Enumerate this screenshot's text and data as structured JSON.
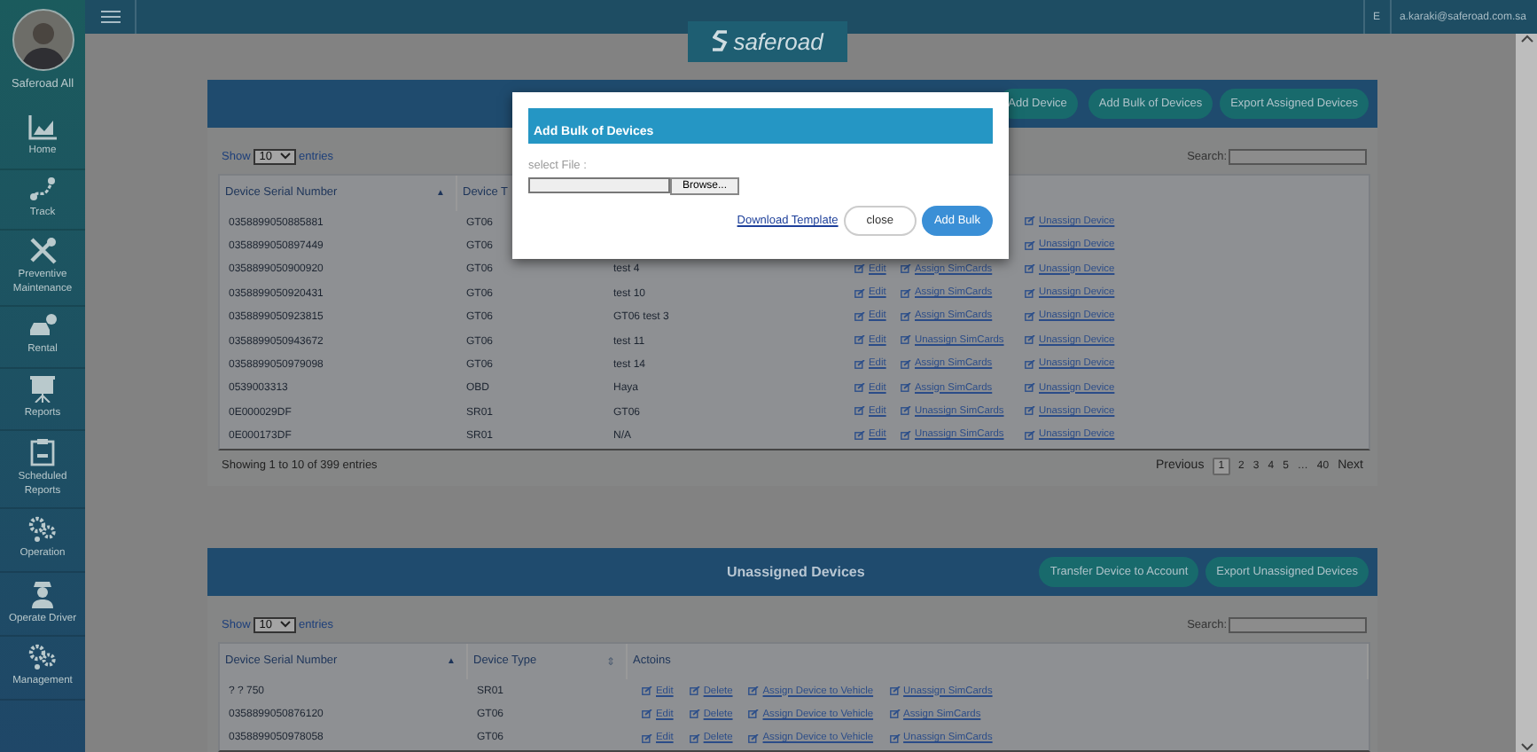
{
  "profile": {
    "name": "Saferoad All"
  },
  "sidebar": [
    {
      "label": "Home"
    },
    {
      "label": "Track"
    },
    {
      "label": "Preventive Maintenance"
    },
    {
      "label": "Rental"
    },
    {
      "label": "Reports"
    },
    {
      "label": "Scheduled Reports"
    },
    {
      "label": "Operation"
    },
    {
      "label": "Operate Driver"
    },
    {
      "label": "Management"
    }
  ],
  "topbar": {
    "language": "E",
    "user_email": "a.karaki@saferoad.com.sa"
  },
  "logo": "saferoad",
  "assigned": {
    "buttons": [
      "Add Device",
      "Add Bulk of Devices",
      "Export Assigned Devices"
    ],
    "show_label": "Show",
    "page_size": "10",
    "entries_label": "entries",
    "search_label": "Search:",
    "columns": [
      {
        "label": "Device Serial Number",
        "sort_glyph": "▲"
      },
      {
        "label": "Device T"
      }
    ],
    "rows": [
      {
        "serial": "0358899050885881",
        "type": "GT06",
        "actions": [
          "Unassign Device"
        ]
      },
      {
        "serial": "0358899050897449",
        "type": "GT06",
        "actions": [
          "Unassign Device"
        ]
      },
      {
        "serial": "0358899050900920",
        "type": "GT06",
        "name": "test 4",
        "actions": [
          "Edit",
          "Assign SimCards",
          "Unassign Device"
        ]
      },
      {
        "serial": "0358899050920431",
        "type": "GT06",
        "name": "test 10",
        "actions": [
          "Edit",
          "Assign SimCards",
          "Unassign Device"
        ]
      },
      {
        "serial": "0358899050923815",
        "type": "GT06",
        "name": "GT06 test 3",
        "actions": [
          "Edit",
          "Assign SimCards",
          "Unassign Device"
        ]
      },
      {
        "serial": "0358899050943672",
        "type": "GT06",
        "name": "test 11",
        "actions": [
          "Edit",
          "Unassign SimCards",
          "Unassign Device"
        ]
      },
      {
        "serial": "0358899050979098",
        "type": "GT06",
        "name": "test 14",
        "actions": [
          "Edit",
          "Assign SimCards",
          "Unassign Device"
        ]
      },
      {
        "serial": "0539003313",
        "type": "OBD",
        "name": "Haya",
        "actions": [
          "Edit",
          "Assign SimCards",
          "Unassign Device"
        ]
      },
      {
        "serial": "0E000029DF",
        "type": "SR01",
        "name": "GT06",
        "actions": [
          "Edit",
          "Unassign SimCards",
          "Unassign Device"
        ]
      },
      {
        "serial": "0E000173DF",
        "type": "SR01",
        "name": "N/A",
        "actions": [
          "Edit",
          "Unassign SimCards",
          "Unassign Device"
        ]
      }
    ],
    "info": "Showing 1 to 10 of 399 entries",
    "pagination": [
      {
        "label": "Previous",
        "kind": "nav",
        "selected": false
      },
      {
        "label": "1",
        "kind": "page",
        "selected": true
      },
      {
        "label": "2",
        "kind": "page",
        "selected": false
      },
      {
        "label": "3",
        "kind": "page",
        "selected": false
      },
      {
        "label": "4",
        "kind": "page",
        "selected": false
      },
      {
        "label": "5",
        "kind": "page",
        "selected": false
      },
      {
        "label": "…",
        "kind": "ellipsis",
        "selected": false
      },
      {
        "label": "40",
        "kind": "page",
        "selected": false
      },
      {
        "label": "Next",
        "kind": "nav",
        "selected": false
      }
    ]
  },
  "unassigned": {
    "title": "Unassigned Devices",
    "buttons": [
      "Transfer Device to Account",
      "Export Unassigned Devices"
    ],
    "show_label": "Show",
    "page_size": "10",
    "entries_label": "entries",
    "search_label": "Search:",
    "columns": [
      {
        "label": "Device Serial Number",
        "sort_glyph": "▲"
      },
      {
        "label": "Device Type",
        "sort_glyph": "⇕"
      },
      {
        "label": "Actoins"
      }
    ],
    "rows": [
      {
        "serial": "? ? 750",
        "type": "SR01",
        "actions": [
          "Edit",
          "Delete",
          "Assign Device to Vehicle",
          "Unassign SimCards"
        ]
      },
      {
        "serial": "0358899050876120",
        "type": "GT06",
        "actions": [
          "Edit",
          "Delete",
          "Assign Device to Vehicle",
          "Assign SimCards"
        ]
      },
      {
        "serial": "0358899050978058",
        "type": "GT06",
        "actions": [
          "Edit",
          "Delete",
          "Assign Device to Vehicle",
          "Unassign SimCards"
        ]
      }
    ]
  },
  "modal": {
    "title": "Add Bulk of Devices",
    "file_label": "select File :",
    "browse": "Browse...",
    "download_link": "Download Template",
    "close": "close",
    "submit": "Add Bulk"
  }
}
